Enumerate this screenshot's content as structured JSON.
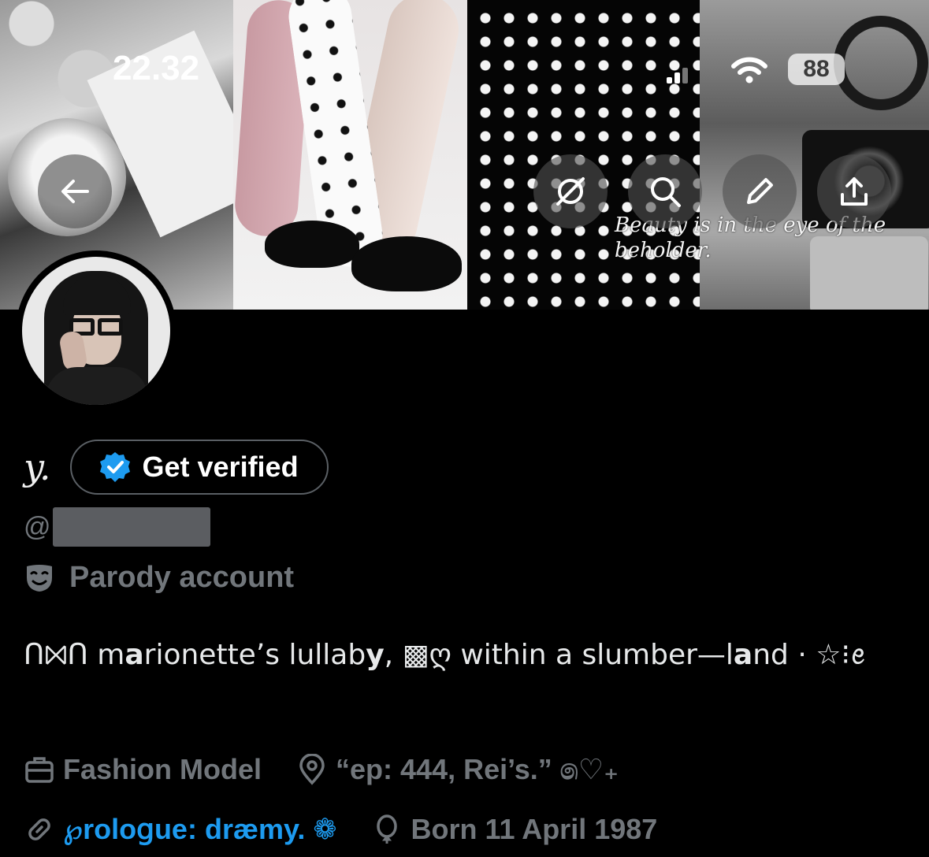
{
  "status_bar": {
    "time": "22.32",
    "battery": "88"
  },
  "header": {
    "banner_text": "Beauty is in the eye of the beholder.",
    "buttons": [
      "back-arrow-icon",
      "grok-icon",
      "search-icon",
      "edit-pencil-icon",
      "share-icon"
    ]
  },
  "profile": {
    "display_name": "y.",
    "verify_label": "Get verified",
    "handle_prefix": "@",
    "parody_label": "Parody account",
    "bio": "ᑎ⨝ᑎ  m𝗮rionette’s  lullab𝘆,  ▩ღ  within  a  slumber—l𝗮nd  ·  ☆⁝ꫀ",
    "occupation": "Fashion Model",
    "location": "“ep: 444, Rei’s.” ෧♡₊",
    "website": "℘rolo𝗀ue: dræmy. ❁",
    "birthday": "Born 11 April 1987"
  },
  "colors": {
    "accent": "#1d9bf0",
    "muted": "#71767b",
    "background": "#000000"
  }
}
